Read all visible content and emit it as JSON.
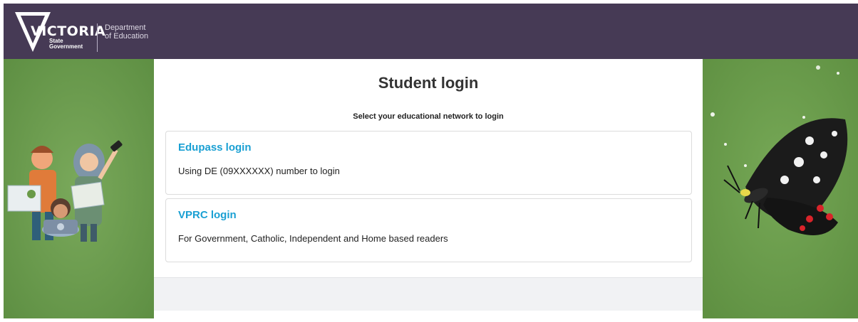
{
  "header": {
    "logo_word": "VICTORIA",
    "logo_state_line1": "State",
    "logo_state_line2": "Government",
    "dept_line1": "Department",
    "dept_line2": "of Education",
    "background_color": "#463a55"
  },
  "main": {
    "title": "Student login",
    "subtitle": "Select your educational network to login",
    "options": [
      {
        "title": "Edupass login",
        "description": "Using DE (09XXXXXX) number to login"
      },
      {
        "title": "VPRC login",
        "description": "For Government, Catholic, Independent and Home based readers"
      }
    ],
    "link_color": "#1aa0d3"
  },
  "decor": {
    "left_illustration": "children-reading-illustration",
    "right_illustration": "butterfly-illustration",
    "side_color": "#689a4b"
  }
}
